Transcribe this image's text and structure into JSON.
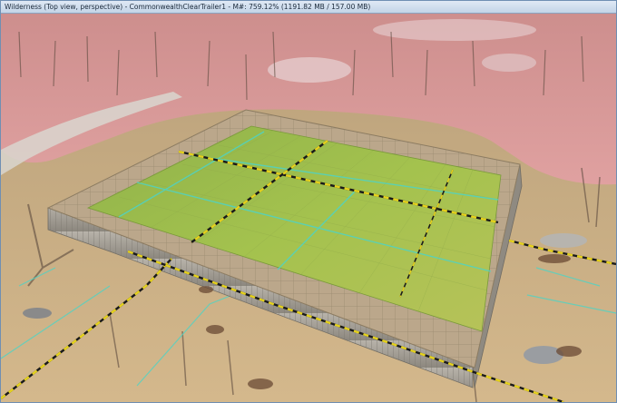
{
  "window": {
    "title": "Wilderness (Top view, perspective) - CommonwealthClearTrailer1 - M#: 759.12% (1191.82 MB / 157.00 MB)"
  },
  "viewport": {
    "scene": "render-viewport",
    "colors": {
      "ground": "#c9a87a",
      "pink_overlay": "#d98a93",
      "foundation_green": "#98b84a",
      "foundation_border": "#b8a486",
      "wall_gray": "#a9a59d",
      "yellow_dash": "#e6d21c",
      "cyan_line": "#4fd3c4"
    }
  }
}
